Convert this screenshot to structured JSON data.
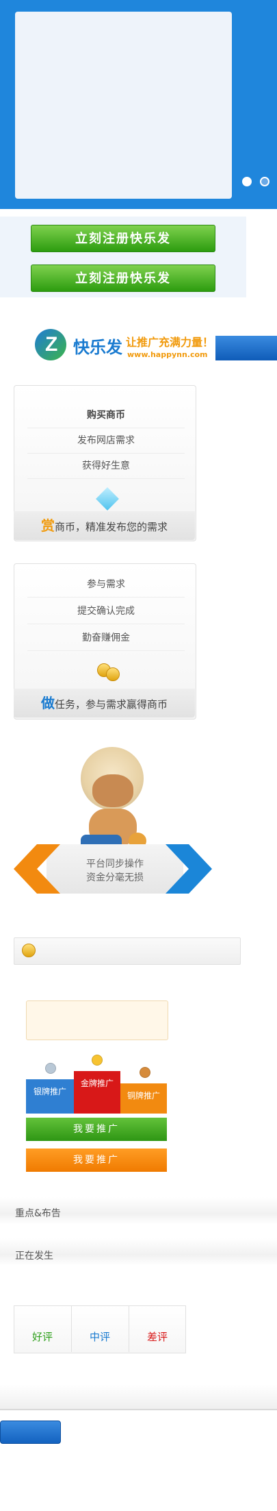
{
  "colors": {
    "banner_blue": "#1f86dc",
    "register_green": "#2c9c0f",
    "brand_blue": "#1a7bd0",
    "brand_orange": "#f19a0c",
    "good_review": "#2fa01c",
    "medium_review": "#1a7bd0",
    "bad_review": "#d81818"
  },
  "register": {
    "button1": "立刻注册快乐发",
    "button2": "立刻注册快乐发"
  },
  "logo": {
    "mark": "Z",
    "name": "快乐发",
    "slogan": "让推广充满力量！",
    "url": "www.happynn.com"
  },
  "card_buy": {
    "items": [
      "购买商币",
      "发布网店需求",
      "获得好生意"
    ],
    "footer_lead": "赏",
    "footer_text": "商币，精准发布您的需求",
    "icon": "diamond-icon"
  },
  "card_task": {
    "items": [
      "参与需求",
      "提交确认完成",
      "勤奋赚佣金"
    ],
    "footer_lead": "做",
    "footer_text": "任务，参与需求赢得商币",
    "icon": "coins-icon"
  },
  "platform": {
    "line1": "平台同步操作",
    "line2": "资金分毫无损"
  },
  "promo": {
    "silver_label": "银牌推广",
    "gold_label": "金牌推广",
    "bronze_label": "铜牌推广",
    "button1": "我要推广",
    "button2": "我要推广"
  },
  "sections": {
    "announcements": "重点&布告",
    "happening": "正在发生"
  },
  "ratings": {
    "good": "好评",
    "medium": "中评",
    "bad": "差评"
  }
}
